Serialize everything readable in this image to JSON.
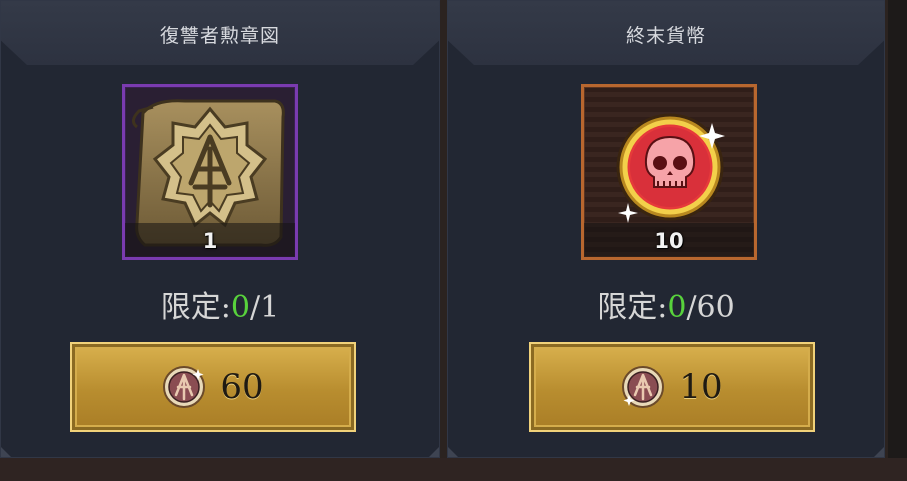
{
  "shop": {
    "items": [
      {
        "title": "復讐者勲章図",
        "quantity": "1",
        "limit_label": "限定:",
        "limit_current": "0",
        "limit_total": "/1",
        "price": "60",
        "currency_icon": "avenger-medal-coin-icon",
        "item_icon": "avenger-medal-blueprint-icon",
        "frame_color": "#7a3bb0"
      },
      {
        "title": "終末貨幣",
        "quantity": "10",
        "limit_label": "限定:",
        "limit_current": "0",
        "limit_total": "/60",
        "price": "10",
        "currency_icon": "avenger-medal-coin-icon",
        "item_icon": "skull-coin-icon",
        "frame_color": "#b8672f"
      }
    ],
    "colors": {
      "limit_current": "#58d23c",
      "button_gold": "#c99e3e",
      "card_bg": "#222733"
    }
  }
}
